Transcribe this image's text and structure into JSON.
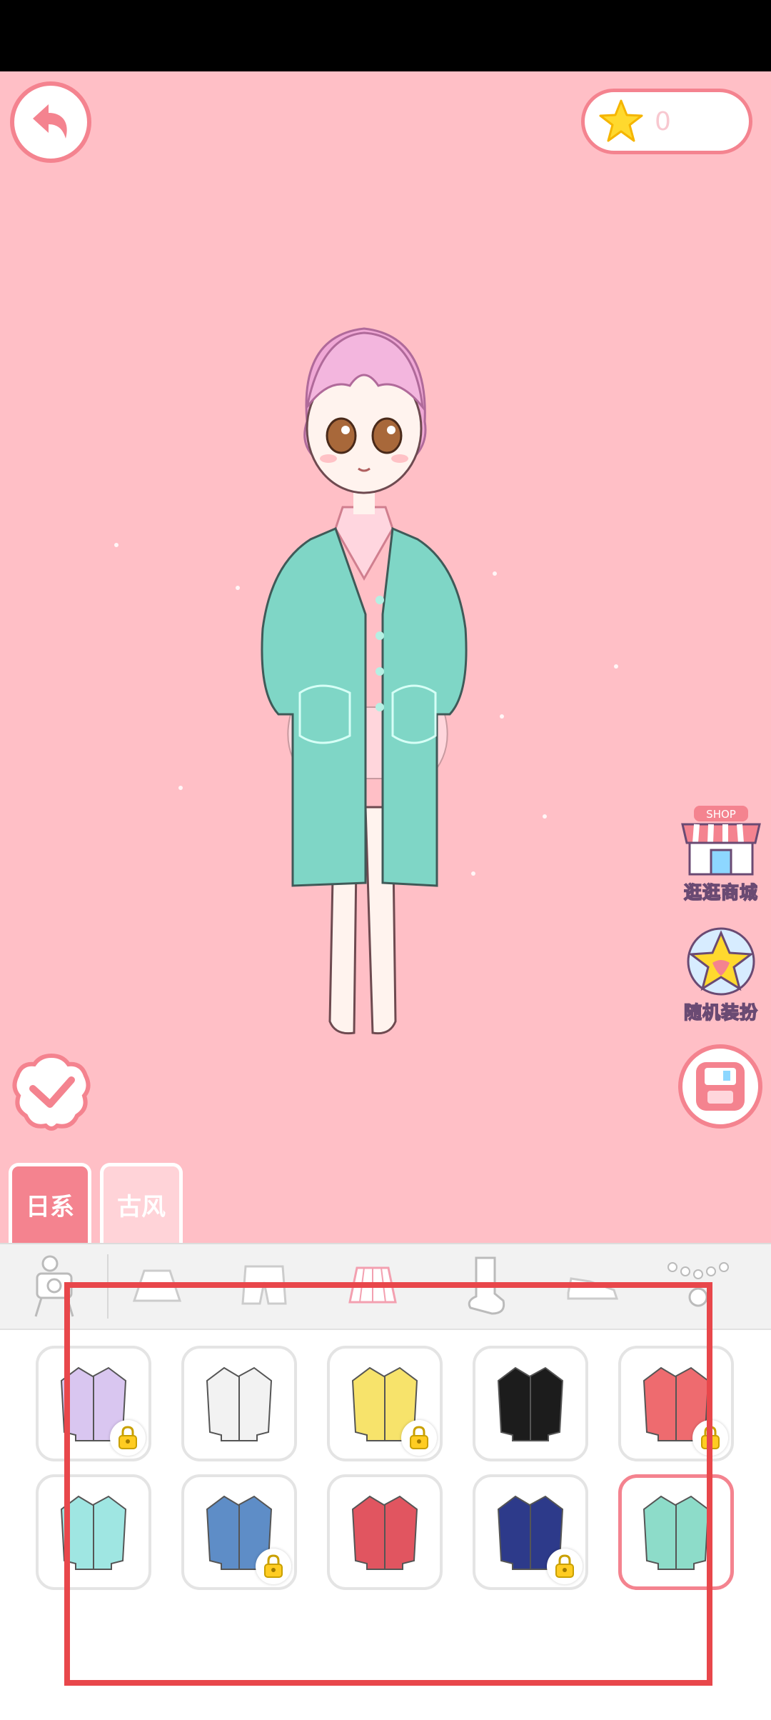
{
  "header": {
    "star_count": "0",
    "star_icon": "star-icon",
    "back_icon": "back-arrow-icon"
  },
  "side_menu": {
    "shop_badge": "SHOP",
    "shop_label": "逛逛商城",
    "random_label": "随机装扮"
  },
  "style_tabs": [
    {
      "label": "日系",
      "selected": true
    },
    {
      "label": "古风",
      "selected": false
    }
  ],
  "categories": [
    {
      "icon": "photo-stand-icon"
    },
    {
      "icon": "skirt-icon"
    },
    {
      "icon": "shorts-icon"
    },
    {
      "icon": "pleated-skirt-icon"
    },
    {
      "icon": "sock-icon"
    },
    {
      "icon": "shoe-icon"
    },
    {
      "icon": "accessory-icon"
    }
  ],
  "items": [
    {
      "name": "lavender-cardigan",
      "color": "#d9c6f0",
      "locked": true
    },
    {
      "name": "white-striped-jacket",
      "color": "#f2f2f2",
      "locked": false
    },
    {
      "name": "yellow-bunny-cardigan",
      "color": "#f7e36b",
      "locked": true
    },
    {
      "name": "black-white-track-jacket",
      "color": "#1c1c1c",
      "locked": false
    },
    {
      "name": "red-crop-cardigan",
      "color": "#ee6b6f",
      "locked": true
    },
    {
      "name": "aqua-jacket",
      "color": "#9fe6e2",
      "locked": false
    },
    {
      "name": "denim-jacket",
      "color": "#5e8dc7",
      "locked": true
    },
    {
      "name": "red-navy-jacket",
      "color": "#e15560",
      "locked": false
    },
    {
      "name": "navy-yellow-hoodie",
      "color": "#2d3a8a",
      "locked": true
    },
    {
      "name": "mint-long-coat",
      "color": "#8ddcc9",
      "locked": false,
      "selected": true
    }
  ],
  "colors": {
    "stage_bg": "#ffbfc6",
    "accent": "#f4838f",
    "highlight": "#e8474b"
  }
}
